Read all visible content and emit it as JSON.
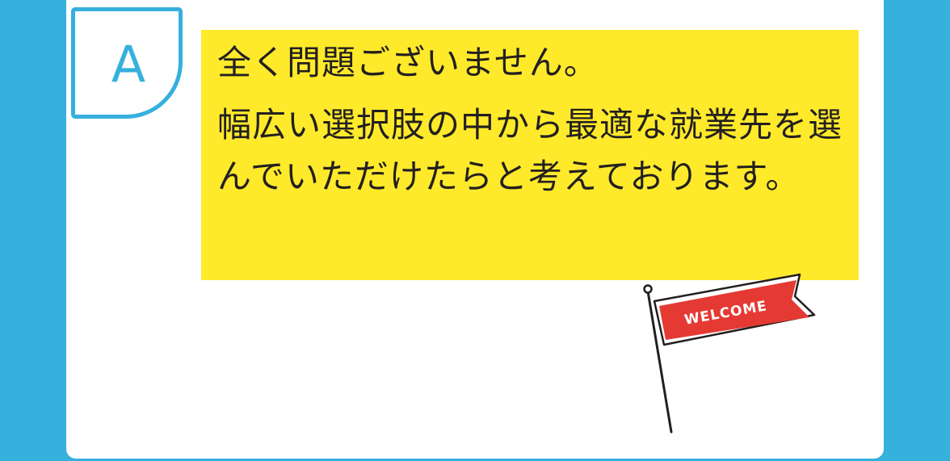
{
  "badge": {
    "letter": "A"
  },
  "answer": {
    "line1": "全く問題ございません。",
    "paragraph": "幅広い選択肢の中から最適な就業先を選んでいただけたらと考えております。"
  },
  "flag": {
    "label": "WELCOME",
    "color": "#e43a33"
  },
  "colors": {
    "accent": "#36b0dd",
    "highlight": "#feea2b",
    "text": "#231f20"
  }
}
